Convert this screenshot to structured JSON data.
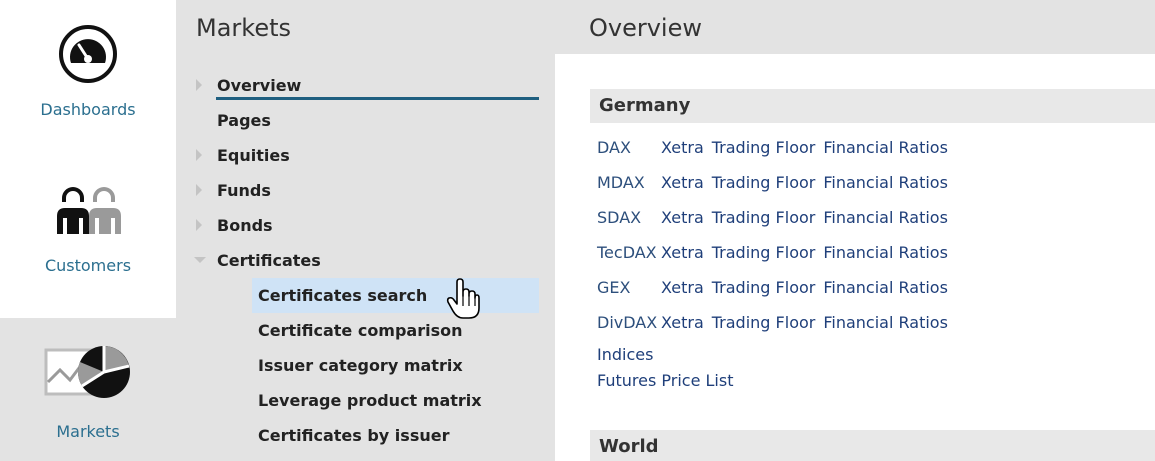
{
  "rail": {
    "items": [
      {
        "label": "Dashboards",
        "icon": "speedometer-icon"
      },
      {
        "label": "Customers",
        "icon": "people-icon"
      },
      {
        "label": "Markets",
        "icon": "markets-chart-icon"
      }
    ],
    "selected": "Markets"
  },
  "nav": {
    "title": "Markets",
    "items": [
      {
        "label": "Overview",
        "expandable": true,
        "active": true
      },
      {
        "label": "Pages",
        "expandable": false
      },
      {
        "label": "Equities",
        "expandable": true
      },
      {
        "label": "Funds",
        "expandable": true
      },
      {
        "label": "Bonds",
        "expandable": true
      },
      {
        "label": "Certificates",
        "expandable": true,
        "expanded": true
      }
    ],
    "sub_items": [
      {
        "label": "Certificates search",
        "hovered": true
      },
      {
        "label": "Certificate comparison"
      },
      {
        "label": "Issuer category matrix"
      },
      {
        "label": "Leverage product matrix"
      },
      {
        "label": "Certificates by issuer"
      }
    ]
  },
  "content": {
    "title": "Overview",
    "sections": [
      {
        "label": "Germany",
        "rows": [
          {
            "code": "DAX",
            "links": [
              "Xetra",
              "Trading Floor",
              "Financial Ratios"
            ]
          },
          {
            "code": "MDAX",
            "links": [
              "Xetra",
              "Trading Floor",
              "Financial Ratios"
            ]
          },
          {
            "code": "SDAX",
            "links": [
              "Xetra",
              "Trading Floor",
              "Financial Ratios"
            ]
          },
          {
            "code": "TecDAX",
            "links": [
              "Xetra",
              "Trading Floor",
              "Financial Ratios"
            ]
          },
          {
            "code": "GEX",
            "links": [
              "Xetra",
              "Trading Floor",
              "Financial Ratios"
            ]
          },
          {
            "code": "DivDAX",
            "links": [
              "Xetra",
              "Trading Floor",
              "Financial Ratios"
            ]
          }
        ],
        "extra_links": [
          "Indices",
          "Futures Price List"
        ]
      },
      {
        "label": "World"
      }
    ]
  },
  "colors": {
    "panel_bg": "#e3e3e3",
    "rail_label": "#2b6f8f",
    "link": "#1f3f7a",
    "hover_bg": "#cfe3f6",
    "active_underline": "#1f5f80"
  }
}
